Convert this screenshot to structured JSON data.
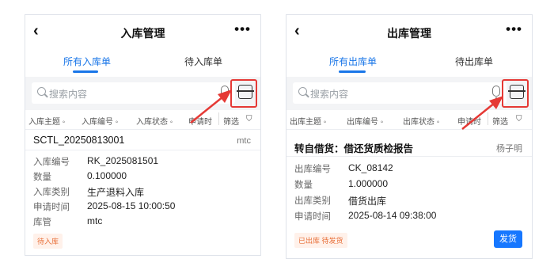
{
  "inbound": {
    "title": "入库管理",
    "back_icon": "‹",
    "more_icon": "•••",
    "tabs": [
      "所有入库单",
      "待入库单"
    ],
    "search_placeholder": "搜索内容",
    "filters": [
      "入库主题 ◦",
      "入库编号 ◦",
      "入库状态 ◦",
      "申请时",
      "筛选"
    ],
    "card": {
      "title": "SCTL_20250813001",
      "owner": "mtc",
      "fields": [
        {
          "label": "入库编号",
          "value": "RK_2025081501"
        },
        {
          "label": "数量",
          "value": "0.100000"
        },
        {
          "label": "入库类别",
          "value": "生产退料入库"
        },
        {
          "label": "申请时间",
          "value": "2025-08-15 10:00:50"
        },
        {
          "label": "库管",
          "value": "mtc"
        }
      ],
      "status": "待入库"
    }
  },
  "outbound": {
    "title": "出库管理",
    "back_icon": "‹",
    "more_icon": "•••",
    "tabs": [
      "所有出库单",
      "待出库单"
    ],
    "search_placeholder": "搜索内容",
    "filters": [
      "出库主题 ◦",
      "出库编号 ◦",
      "出库状态 ◦",
      "申请时",
      "筛选"
    ],
    "card": {
      "title": "转自借货：借还货质检报告",
      "owner": "杨子明",
      "fields": [
        {
          "label": "出库编号",
          "value": "CK_08142"
        },
        {
          "label": "数量",
          "value": "1.000000"
        },
        {
          "label": "出库类别",
          "value": "借货出库"
        },
        {
          "label": "申请时间",
          "value": "2025-08-14 09:38:00"
        }
      ],
      "status": "已出库 待发货",
      "action_label": "发货"
    }
  },
  "colors": {
    "accent": "#1976e8",
    "highlight": "#e53935",
    "status": "#e8703a"
  }
}
